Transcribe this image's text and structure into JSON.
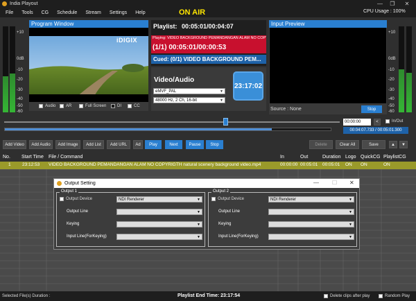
{
  "window": {
    "title": "India Playout",
    "minimize": "—",
    "restore": "❐",
    "close": "✕"
  },
  "menu": [
    "File",
    "Tools",
    "CG",
    "Schedule",
    "Stream",
    "Settings",
    "Help"
  ],
  "on_air": "ON AIR",
  "cpu_usage": "CPU Usage : 100%",
  "vu_left": {
    "ticks": [
      "+10",
      "0dB",
      "-10",
      "-20",
      "-30",
      "-40",
      "-50",
      "-60"
    ],
    "levels": [
      0.42,
      0.45
    ]
  },
  "vu_right": {
    "ticks": [
      "+10",
      "0dB",
      "-10",
      "-20",
      "-30",
      "-40",
      "-50",
      "-60"
    ],
    "levels": [
      0.5,
      0.46
    ]
  },
  "program": {
    "title": "Program Window",
    "logo": "iDIGIX",
    "checkboxes": [
      {
        "label": "Audio",
        "checked": false
      },
      {
        "label": "AR",
        "checked": false
      },
      {
        "label": "Full Screen",
        "checked": false
      },
      {
        "label": "DI",
        "checked": true
      },
      {
        "label": "CC",
        "checked": false
      }
    ]
  },
  "playlist": {
    "header": "Playlist:",
    "total_time": "00:05:01/00:04:07",
    "playing_label": "Playing: VIDEO BACKGROUND PEMANDANGAN ALAM NO COPYRI",
    "playing_time": "(1/1) 00:05:01/00:00:53",
    "cued": "Cued: (0/1) VIDEO BACKGROUND PEM..."
  },
  "video_audio": {
    "title": "Video/Audio",
    "video_format": "eMVF_PAL",
    "audio_format": "48000 Hz, 2 Ch, 16-bit",
    "clock": "23:17:02"
  },
  "input_preview": {
    "title": "Input Preview",
    "source": "Source : None",
    "stop_label": "Stop"
  },
  "transport": {
    "timecode": "00:00:00",
    "in_out_label": "In/Out",
    "position": "00:04:07.733 / 00:05:01.300",
    "progress": 0.82,
    "scrub": 0.66
  },
  "toolbar": {
    "add_video": "Add Video",
    "add_audio": "Add Audio",
    "add_image": "Add Image",
    "add_list": "Add List",
    "add_url": "Add URL",
    "ad": "Ad",
    "play": "Play",
    "next": "Next",
    "pause": "Pause",
    "stop": "Stop",
    "delete": "Delete",
    "clear_all": "Clear All",
    "save": "Save",
    "up": "▲",
    "down": "▼"
  },
  "table": {
    "headers": [
      "No.",
      "Start Time",
      "File / Command",
      "In",
      "Out",
      "Duration",
      "Logo",
      "QuickCG",
      "PlaylistCG"
    ],
    "rows": [
      {
        "no": "1",
        "start": "23:12:53",
        "file": "VIDEO BACKGROUND PEMANDANGAN ALAM NO COPYRIGTH natural scenery background video.mp4",
        "in": "00:00:00",
        "out": "00:05:01",
        "duration": "00:05:01",
        "logo": "ON",
        "quickcg": "ON",
        "playlistcg": "ON"
      }
    ]
  },
  "dialog": {
    "title": "Output Setting",
    "output1": {
      "label": "Output 1",
      "device_label": "Output Device",
      "device_value": "NDI Renderer",
      "line_label": "Output Line",
      "keying_label": "Keying",
      "input_line_label": "Input Line(ForKeying)"
    },
    "output2": {
      "label": "Output 2",
      "device_label": "Output Device",
      "device_value": "NDI Renderer",
      "line_label": "Output Line",
      "keying_label": "Keying",
      "input_line_label": "Input Line(ForKeying)"
    }
  },
  "status": {
    "selected": "Selected File(s) Duration :",
    "end_time": "Playlist End Time:  23:17:54",
    "delete_after": "Delete clips after play",
    "random": "Random Play"
  }
}
